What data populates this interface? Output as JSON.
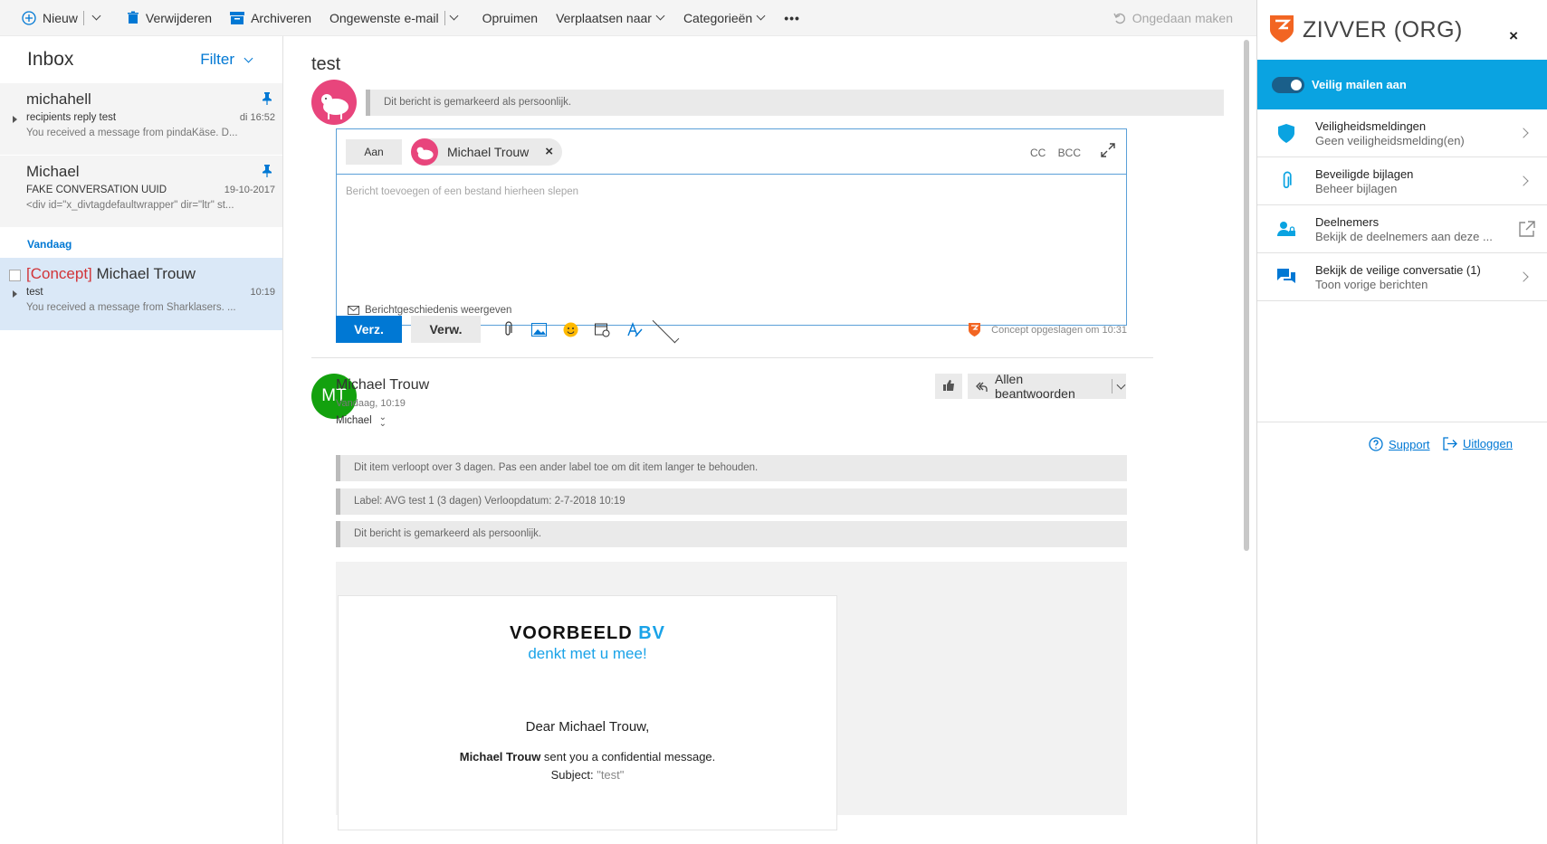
{
  "toolbar": {
    "new_label": "Nieuw",
    "delete_label": "Verwijderen",
    "archive_label": "Archiveren",
    "junk_label": "Ongewenste e-mail",
    "sweep_label": "Opruimen",
    "move_label": "Verplaatsen naar",
    "categories_label": "Categorieën",
    "more_label": "•••",
    "undo_label": "Ongedaan maken"
  },
  "inbox": {
    "title": "Inbox",
    "filter_label": "Filter",
    "messages": [
      {
        "from": "michahell",
        "subject": "recipients reply test",
        "time": "di 16:52",
        "preview": "You received a message from pindaKäse.    D..."
      },
      {
        "from": "Michael",
        "subject": "FAKE CONVERSATION UUID",
        "time": "19-10-2017",
        "preview": "<div id=\"x_divtagdefaultwrapper\" dir=\"ltr\" st..."
      }
    ],
    "group_label": "Vandaag",
    "selected": {
      "concept_tag": "[Concept]",
      "from": " Michael Trouw",
      "subject": "test",
      "time": "10:19",
      "preview": "You received a message from Sharklasers.    ..."
    }
  },
  "reading": {
    "subject": "test",
    "personal_notice": "Dit bericht is gemarkeerd als persoonlijk.",
    "compose": {
      "to_label": "Aan",
      "recipient": "Michael Trouw",
      "remove": "×",
      "cc": "CC",
      "bcc": "BCC",
      "body_placeholder": "Bericht toevoegen of een bestand hierheen slepen",
      "history_label": "Berichtgeschiedenis weergeven",
      "send_label": "Verz.",
      "discard_label": "Verw.",
      "draft_saved": "Concept opgeslagen om 10:31"
    },
    "message": {
      "initials": "MT",
      "sender": "Michael Trouw",
      "date": "Vandaag, 10:19",
      "to": "Michael",
      "reply_all_label": "Allen beantwoorden",
      "notices": [
        "Dit item verloopt over 3 dagen. Pas een ander label toe om dit item langer te behouden.",
        "Label: AVG test 1 (3 dagen) Verloopdatum: 2-7-2018 10:19",
        "Dit bericht is gemarkeerd als persoonlijk."
      ],
      "brand_name": "VOORBEELD",
      "brand_suffix": "BV",
      "brand_tagline": "denkt met u mee!",
      "greeting": "Dear Michael Trouw,",
      "sender_bold": "Michael Trouw",
      "sent_text": " sent you a confidential message.",
      "subject_label": "Subject: ",
      "subject_value": "\"test\""
    }
  },
  "zivver": {
    "title": "ZIVVER (ORG)",
    "close": "×",
    "toggle_label": "Veilig mailen  aan",
    "items": [
      {
        "title": "Veiligheidsmeldingen",
        "subtitle": "Geen veiligheidsmelding(en)"
      },
      {
        "title": "Beveiligde bijlagen",
        "subtitle": "Beheer bijlagen"
      },
      {
        "title": "Deelnemers",
        "subtitle": "Bekijk de deelnemers aan deze ..."
      },
      {
        "title": "Bekijk de veilige conversatie (1)",
        "subtitle": "Toon vorige berichten"
      }
    ],
    "support_label": "Support",
    "logout_label": "Uitloggen"
  },
  "colors": {
    "accent": "#0078d4",
    "zivver_blue": "#0aa3e1",
    "zivver_orange": "#f26522",
    "concept_red": "#d13438",
    "avatar_green": "#13a10e",
    "avatar_pink": "#e8457c"
  },
  "icons": [
    "plus-circle-icon",
    "trash-icon",
    "archive-icon",
    "undo-icon",
    "pin-icon",
    "expand-icon",
    "envelope-icon",
    "paperclip-icon",
    "image-icon",
    "emoji-icon",
    "calendar-icon",
    "format-icon",
    "zivver-logo-icon",
    "thumbs-up-icon",
    "reply-all-icon",
    "shield-icon",
    "people-lock-icon",
    "chat-icon",
    "external-link-icon",
    "help-icon",
    "logout-icon"
  ]
}
